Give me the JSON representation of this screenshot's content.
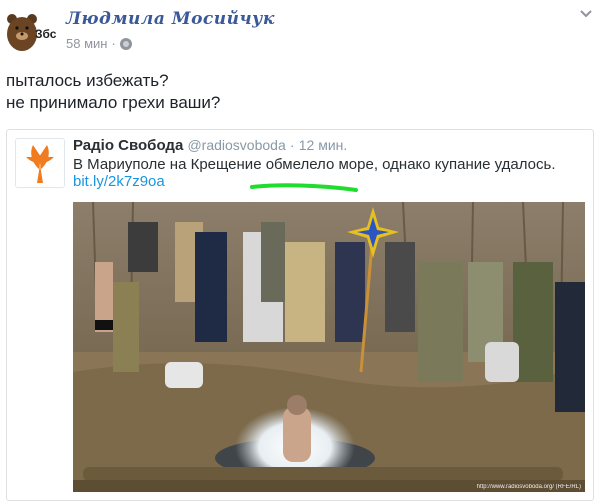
{
  "post": {
    "author": "Людмила Мосийчук",
    "avatar_text": "Збс",
    "time": "58 мин",
    "separator": "·",
    "lines": [
      "пыталось избежать?",
      "не принимало грехи ваши?"
    ]
  },
  "embed": {
    "source_name": "Радіо Свобода",
    "handle": "@radiosvoboda",
    "time_sep": "·",
    "time": "12 мин.",
    "text": "В Мариуполе на Крещение обмелело море, однако купание удалось.",
    "link": "bit.ly/2k7z9oa",
    "photo_credit": "http://www.radiosvoboda.org/ (RFE/RL)"
  },
  "colors": {
    "author": "#3b5998",
    "meta": "#90949c",
    "link": "#1b95e0",
    "rs_orange": "#f07c1f",
    "highlight": "#1fdc2f"
  },
  "icons": {
    "avatar": "bear-icon",
    "privacy": "globe-icon",
    "menu": "chevron-down-icon",
    "source": "radio-svoboda-logo"
  }
}
